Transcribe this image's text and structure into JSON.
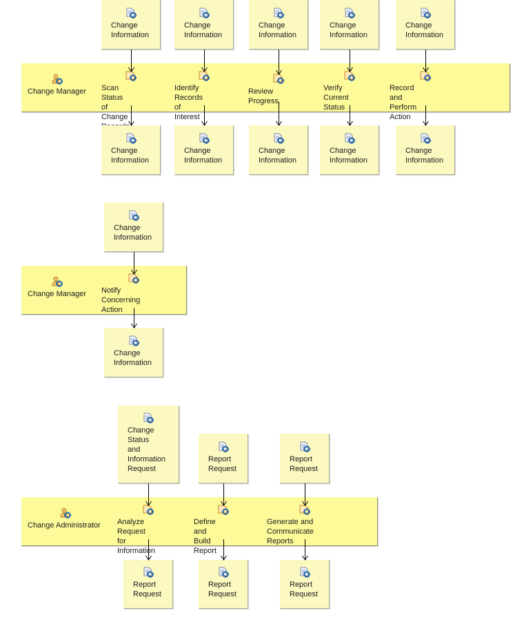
{
  "diagrams": [
    {
      "lane": {
        "role": "Change Manager"
      },
      "tasks": [
        {
          "label": "Scan Status of\nChange Records",
          "input": "Change\nInformation",
          "output": "Change\nInformation"
        },
        {
          "label": "Identify Records\nof Interest",
          "input": "Change\nInformation",
          "output": "Change\nInformation"
        },
        {
          "label": "Review Progress",
          "input": "Change\nInformation",
          "output": "Change\nInformation"
        },
        {
          "label": "Verify Current\nStatus",
          "input": "Change\nInformation",
          "output": "Change\nInformation"
        },
        {
          "label": "Record and Perform\nAction",
          "input": "Change\nInformation",
          "output": "Change\nInformation"
        }
      ]
    },
    {
      "lane": {
        "role": "Change Manager"
      },
      "tasks": [
        {
          "label": "Notify Concerning\nAction",
          "input": "Change\nInformation",
          "output": "Change\nInformation"
        }
      ]
    },
    {
      "lane": {
        "role": "Change Administrator"
      },
      "tasks": [
        {
          "label": "Analyze Request\nfor Information",
          "input": "Change\nStatus\nand\nInformation\nRequest",
          "output": "Report\nRequest"
        },
        {
          "label": "Define and Build\nReport",
          "input": "Report\nRequest",
          "output": "Report\nRequest"
        },
        {
          "label": "Generate and\nCommunicate Reports",
          "input": "Report\nRequest",
          "output": "Report\nRequest"
        }
      ]
    }
  ],
  "icons": {
    "work_product": "work-product-icon",
    "task": "task-icon",
    "role": "role-icon"
  },
  "colors": {
    "lane_fill": "#fdfa9a",
    "box_fill": "#fbf8c0",
    "connector": "#000000",
    "icon_blue": "#1d5fa8",
    "icon_orange": "#d99a3a"
  }
}
